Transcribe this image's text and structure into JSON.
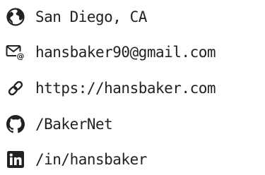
{
  "contact": {
    "location": {
      "text": "San Diego, CA",
      "icon": "globe-icon"
    },
    "email": {
      "text": "hansbaker90@gmail.com",
      "icon": "email-icon"
    },
    "website": {
      "text": "https://hansbaker.com",
      "icon": "link-icon"
    },
    "github": {
      "text": "/BakerNet",
      "icon": "github-icon"
    },
    "linkedin": {
      "text": "/in/hansbaker",
      "icon": "linkedin-icon"
    }
  },
  "colors": {
    "text": "#222222",
    "icon": "#222222"
  }
}
